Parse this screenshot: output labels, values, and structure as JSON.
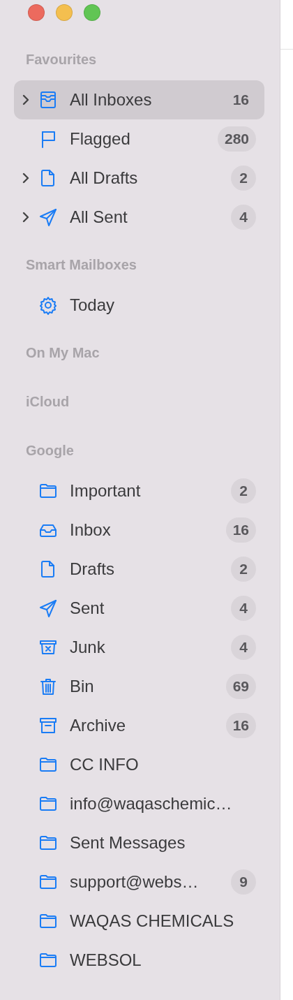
{
  "window_controls": [
    {
      "kind": "close"
    },
    {
      "kind": "minimize"
    },
    {
      "kind": "zoom"
    }
  ],
  "sections": [
    {
      "title": "Favourites",
      "items": [
        {
          "kind": "inboxes",
          "label": "All Inboxes",
          "count": "16",
          "expandable": true,
          "selected": true
        },
        {
          "kind": "flag",
          "label": "Flagged",
          "count": "280",
          "expandable": false,
          "selected": false
        },
        {
          "kind": "drafts",
          "label": "All Drafts",
          "count": "2",
          "expandable": true,
          "selected": false
        },
        {
          "kind": "sent",
          "label": "All Sent",
          "count": "4",
          "expandable": true,
          "selected": false
        }
      ]
    },
    {
      "title": "Smart Mailboxes",
      "items": [
        {
          "kind": "smart",
          "label": "Today",
          "expandable": false,
          "selected": false
        }
      ]
    },
    {
      "title": "On My Mac"
    },
    {
      "title": "iCloud"
    },
    {
      "title": "Google",
      "items": [
        {
          "kind": "folder",
          "label": "Important",
          "count": "2",
          "expandable": false,
          "selected": false
        },
        {
          "kind": "inbox",
          "label": "Inbox",
          "count": "16",
          "expandable": false,
          "selected": false
        },
        {
          "kind": "drafts",
          "label": "Drafts",
          "count": "2",
          "expandable": false,
          "selected": false
        },
        {
          "kind": "sent",
          "label": "Sent",
          "count": "4",
          "expandable": false,
          "selected": false
        },
        {
          "kind": "junk",
          "label": "Junk",
          "count": "4",
          "expandable": false,
          "selected": false
        },
        {
          "kind": "bin",
          "label": "Bin",
          "count": "69",
          "expandable": false,
          "selected": false
        },
        {
          "kind": "archive",
          "label": "Archive",
          "count": "16",
          "expandable": false,
          "selected": false
        },
        {
          "kind": "folder",
          "label": "CC INFO",
          "expandable": false,
          "selected": false
        },
        {
          "kind": "folder",
          "label": "info@waqaschemic…",
          "expandable": false,
          "selected": false
        },
        {
          "kind": "folder",
          "label": "Sent Messages",
          "expandable": false,
          "selected": false
        },
        {
          "kind": "folder",
          "label": "support@webs…",
          "count": "9",
          "expandable": false,
          "selected": false
        },
        {
          "kind": "folder",
          "label": "WAQAS CHEMICALS",
          "expandable": false,
          "selected": false
        },
        {
          "kind": "folder",
          "label": "WEBSOL",
          "expandable": false,
          "selected": false
        }
      ]
    }
  ]
}
